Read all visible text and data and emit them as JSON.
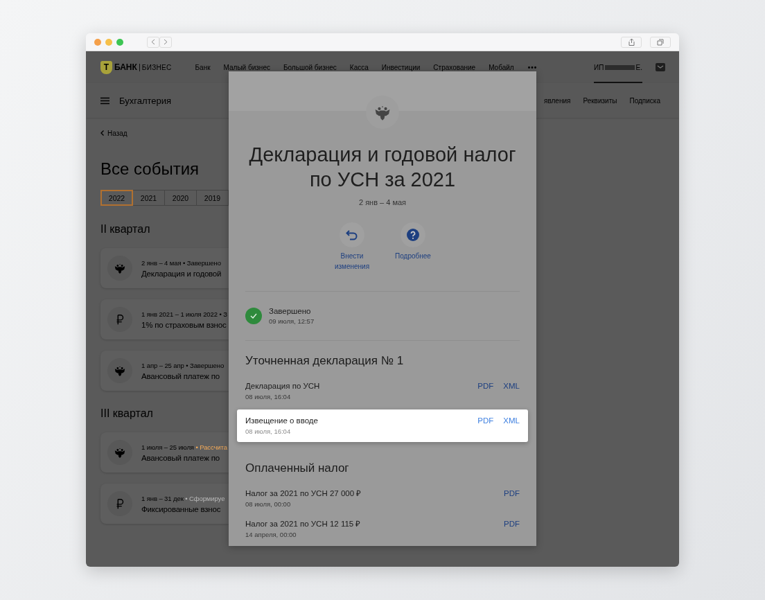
{
  "header": {
    "logo": {
      "letter": "Т",
      "name": "БАНК",
      "suffix": "БИЗНЕС"
    },
    "nav": [
      "Банк",
      "Малый бизнес",
      "Большой бизнес",
      "Касса",
      "Инвестиции",
      "Страхование",
      "Мобайл"
    ],
    "more": "•••",
    "account": {
      "prefix": "ИП",
      "suffix": "Е."
    },
    "section": "Бухгалтерия",
    "links": [
      "явления",
      "Реквизиты",
      "Подписка"
    ]
  },
  "page": {
    "back": "Назад",
    "title": "Все события",
    "years": [
      {
        "label": "2022",
        "selected": true
      },
      {
        "label": "2021",
        "selected": false
      },
      {
        "label": "2020",
        "selected": false
      },
      {
        "label": "2019",
        "selected": false
      }
    ],
    "groups": [
      {
        "title": "II квартал",
        "events": [
          {
            "kind": "tax",
            "dates": "2 янв – 4 мая",
            "status": "• Завершено",
            "color": "#000000",
            "title": "Декларация и годовой"
          },
          {
            "kind": "contribution",
            "dates": "1 янв 2021 – 1 июля 2022",
            "status": "• З",
            "color": "#000000",
            "title": "1% по страховым взнос"
          },
          {
            "kind": "tax",
            "dates": "1 апр – 25 апр",
            "status": "• Завершено",
            "color": "#000000",
            "title": "Авансовый платеж по"
          }
        ]
      },
      {
        "title": "III квартал",
        "events": [
          {
            "kind": "tax",
            "dates": "1 июля – 25 июля",
            "status": "• Рассчита",
            "color": "#f0a858",
            "title": "Авансовый платеж по"
          },
          {
            "kind": "contribution",
            "dates": "1 янв – 31 дек",
            "status": "• Сформируе",
            "color": "#b8b8b8",
            "title": "Фиксированные взнос"
          }
        ]
      }
    ]
  },
  "modal": {
    "title": "Декларация и годовой налог по УСН за 2021",
    "dates": "2 янв – 4 мая",
    "actions": [
      {
        "kind": "undo",
        "label": "Внести изменения"
      },
      {
        "kind": "help",
        "label": "Подробнее"
      }
    ],
    "status": {
      "label": "Завершено",
      "time": "09 июля, 12:57"
    },
    "sections": [
      {
        "title": "Уточненная декларация № 1",
        "docs": [
          {
            "name": "Декларация по УСН",
            "time": "08 июля, 16:04",
            "highlighted": false,
            "links": [
              "PDF",
              "XML"
            ]
          },
          {
            "name": "Извещение о вводе",
            "time": "08 июля, 16:04",
            "highlighted": true,
            "links": [
              "PDF",
              "XML"
            ]
          }
        ]
      },
      {
        "title": "Оплаченный налог",
        "docs": [
          {
            "name": "Налог за 2021 по УСН 27 000 ₽",
            "time": "08 июля, 00:00",
            "highlighted": false,
            "links": [
              "PDF"
            ]
          },
          {
            "name": "Налог за 2021 по УСН 12 115 ₽",
            "time": "14 апреля, 00:00",
            "highlighted": false,
            "links": [
              "PDF"
            ]
          }
        ]
      }
    ]
  }
}
